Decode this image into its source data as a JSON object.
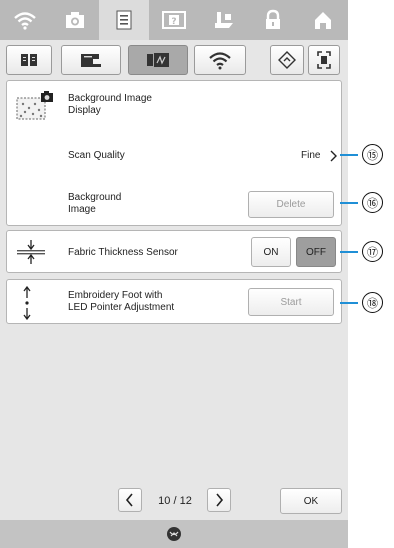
{
  "top_tabs": [
    {
      "icon": "wifi-signal-icon"
    },
    {
      "icon": "camera-icon"
    },
    {
      "icon": "document-icon"
    },
    {
      "icon": "help-icon"
    },
    {
      "icon": "presser-foot-icon"
    },
    {
      "icon": "lock-icon"
    },
    {
      "icon": "home-icon"
    }
  ],
  "sub_tabs": [
    {
      "icon": "book-icon"
    },
    {
      "icon": "sewing-machine-icon"
    },
    {
      "icon": "embroidery-icon"
    },
    {
      "icon": "wifi-icon"
    }
  ],
  "settings": {
    "background_image": {
      "title_line1": "Background Image",
      "title_line2": "Display"
    },
    "scan_quality": {
      "label": "Scan Quality",
      "value": "Fine"
    },
    "background_image_delete": {
      "label_line1": "Background",
      "label_line2": "Image",
      "button": "Delete"
    },
    "fabric_thickness": {
      "label": "Fabric Thickness Sensor",
      "on": "ON",
      "off": "OFF",
      "selected": "OFF"
    },
    "embroidery_foot": {
      "label_line1": "Embroidery Foot with",
      "label_line2": "LED Pointer Adjustment",
      "button": "Start"
    }
  },
  "pagination": {
    "text": "10 / 12"
  },
  "ok_button": "OK",
  "callouts": [
    "⑮",
    "⑯",
    "⑰",
    "⑱"
  ],
  "colors": {
    "callout_line": "#1f8fd6",
    "top_bar": "#b9b9b9",
    "screen_bg": "#e6e6e6"
  }
}
